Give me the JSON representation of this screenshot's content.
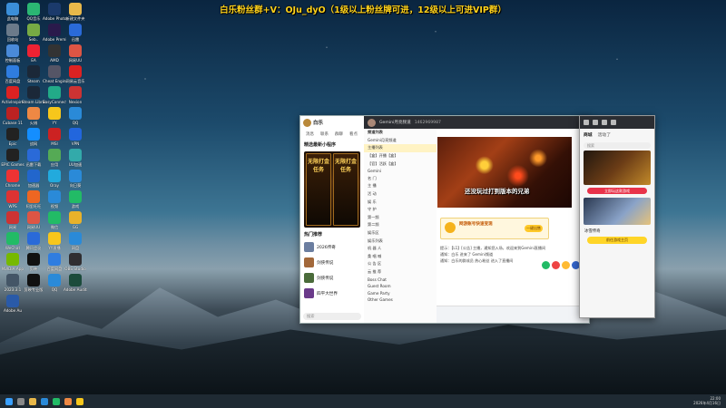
{
  "banner": "白乐粉丝群+V：OJu_dyO（1级以上粉丝牌可进，12级以上可进VIP群）",
  "desktop_icons": [
    {
      "label": "此电脑",
      "color": "#3b8ed8"
    },
    {
      "label": "QQ音乐",
      "color": "#2bb673"
    },
    {
      "label": "Adobe Photoshop",
      "color": "#1b3a6b"
    },
    {
      "label": "新建文件夹",
      "color": "#e8b84a"
    },
    {
      "label": "回收站",
      "color": "#6b7a8a"
    },
    {
      "label": "Seb..",
      "color": "#7a4"
    },
    {
      "label": "Adobe Premiere",
      "color": "#2a1a4b"
    },
    {
      "label": "迅雷",
      "color": "#2a6ad8"
    },
    {
      "label": "控制面板",
      "color": "#4a8ad8"
    },
    {
      "label": "EA",
      "color": "#e23"
    },
    {
      "label": "AMD",
      "color": "#333"
    },
    {
      "label": "网易UU",
      "color": "#d54"
    },
    {
      "label": "百度网盘",
      "color": "#2f7de0"
    },
    {
      "label": "Steam",
      "color": "#1b2838"
    },
    {
      "label": "Cheat Engine",
      "color": "#556"
    },
    {
      "label": "网易云音乐",
      "color": "#d22"
    },
    {
      "label": "ActivInspire",
      "color": "#d22"
    },
    {
      "label": "Steam Library",
      "color": "#1b2838"
    },
    {
      "label": "EasyConnect",
      "color": "#2a8"
    },
    {
      "label": "Nexion",
      "color": "#c33"
    },
    {
      "label": "Cubase 11",
      "color": "#b22"
    },
    {
      "label": "火绒",
      "color": "#e84"
    },
    {
      "label": "YY",
      "color": "#f7c61b"
    },
    {
      "label": "QQ",
      "color": "#2a8ad8"
    },
    {
      "label": "Epic",
      "color": "#222"
    },
    {
      "label": "战网",
      "color": "#148eff"
    },
    {
      "label": "MSI",
      "color": "#c22"
    },
    {
      "label": "VPN",
      "color": "#26d"
    },
    {
      "label": "EPIC Games",
      "color": "#222"
    },
    {
      "label": "迅雷下载",
      "color": "#2a6ad8"
    },
    {
      "label": "应用",
      "color": "#5a5"
    },
    {
      "label": "UU加速",
      "color": "#3aa"
    },
    {
      "label": "Chrome",
      "color": "#e33"
    },
    {
      "label": "加速器",
      "color": "#26c"
    },
    {
      "label": "Oray",
      "color": "#2ad"
    },
    {
      "label": "向日葵",
      "color": "#2a8ad8"
    },
    {
      "label": "WPS",
      "color": "#d33"
    },
    {
      "label": "阿里旺旺",
      "color": "#e62"
    },
    {
      "label": "视频",
      "color": "#2a8ad8"
    },
    {
      "label": "游戏",
      "color": "#2b6"
    },
    {
      "label": "网易",
      "color": "#c33"
    },
    {
      "label": "网易UU",
      "color": "#d54"
    },
    {
      "label": "微信",
      "color": "#2b6"
    },
    {
      "label": "GG",
      "color": "#e8b22a"
    },
    {
      "label": "WeChat",
      "color": "#2b6"
    },
    {
      "label": "腾讯会议",
      "color": "#2a6ad8"
    },
    {
      "label": "YY直播",
      "color": "#f7c61b"
    },
    {
      "label": "网盘",
      "color": "#2a8ad8"
    },
    {
      "label": "NVIDIA App",
      "color": "#76b900"
    },
    {
      "label": "剪映",
      "color": "#111"
    },
    {
      "label": "百度网盘",
      "color": "#2f7de0"
    },
    {
      "label": "OBS Studio",
      "color": "#302e31"
    },
    {
      "label": "2023.3.1",
      "color": "#456"
    },
    {
      "label": "剪映专业版",
      "color": "#111"
    },
    {
      "label": "QQ",
      "color": "#2a8ad8"
    },
    {
      "label": "Adobe Audition",
      "color": "#1b4b3b"
    },
    {
      "label": "Adobe Au",
      "color": "#2a5aa8"
    }
  ],
  "qq": {
    "title": "白乐",
    "tabs": [
      "消息",
      "联系",
      "群聊",
      "看点"
    ],
    "section": "精选最新小程序",
    "promo_cards": [
      "无限打金任务",
      "无限打金任务"
    ],
    "mini_section": "热门推荐",
    "mini_items": [
      "2026传奇",
      "剑侠传说",
      "剑侠传说",
      "四平大世界"
    ],
    "search_placeholder": "搜索"
  },
  "yy": {
    "channel": "Gemini月亮频道",
    "channel_id": "1462969987",
    "list_header": "频道列表",
    "list": [
      "Gemini月亮频道",
      "主播列表",
      "【盒】开播【盒】",
      "【官】活跃【盒】",
      "Gemini",
      "名 门",
      "主 播",
      "活 动",
      "娱 乐",
      "守 护",
      "第一频",
      "第二频",
      "娱乐区",
      "娱乐列表",
      "机 器 人",
      "桑 唱 喊",
      "公 告 区",
      "云 推 荐",
      "Boss Chat",
      "Guest Room",
      "Game Party",
      "Other Games"
    ],
    "video_caption": "还没玩过打到版本的兄弟",
    "ad_title": "网游账号快速变现",
    "ad_btn": "一键出售",
    "chat": [
      "提示：【L1】[公告] 主播，通知您入场，欢迎来到Gemini直播间",
      "通知：白乐 进来了 Gemini频道",
      "通知：白乐的群成员 热心粉丝 进入了直播间"
    ]
  },
  "rpanel": {
    "tabs": [
      "商城",
      "活动了"
    ],
    "search": "搜索",
    "red_btn": "立即玩这款游戏",
    "game": "冰雪传奇",
    "yellow_btn": "前往游戏主页"
  },
  "tray": {
    "time": "22:00",
    "date": "2026年4月16日"
  }
}
